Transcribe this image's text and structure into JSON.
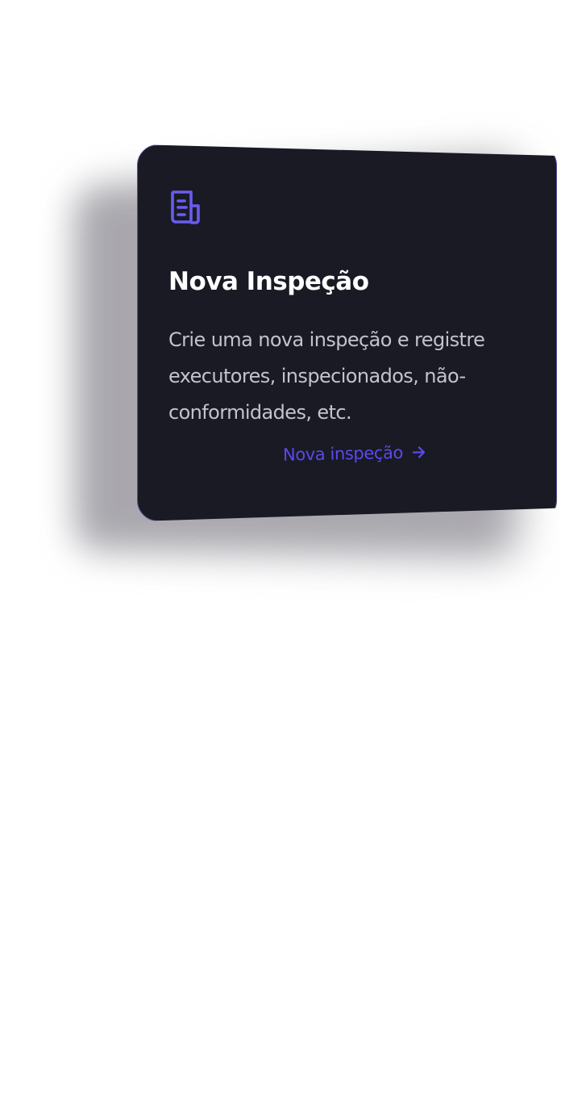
{
  "card": {
    "icon": "document-icon",
    "title": "Nova Inspeção",
    "description": "Crie uma nova inspeção e registre executores, inspecionados, não-conformidades, etc.",
    "link_label": "Nova inspeção",
    "link_icon": "arrow-right-icon"
  },
  "colors": {
    "card_background": "#191a24",
    "accent": "#5a49f0",
    "icon": "#6a5cf0",
    "title": "#ffffff",
    "description": "#c2c3cc"
  }
}
